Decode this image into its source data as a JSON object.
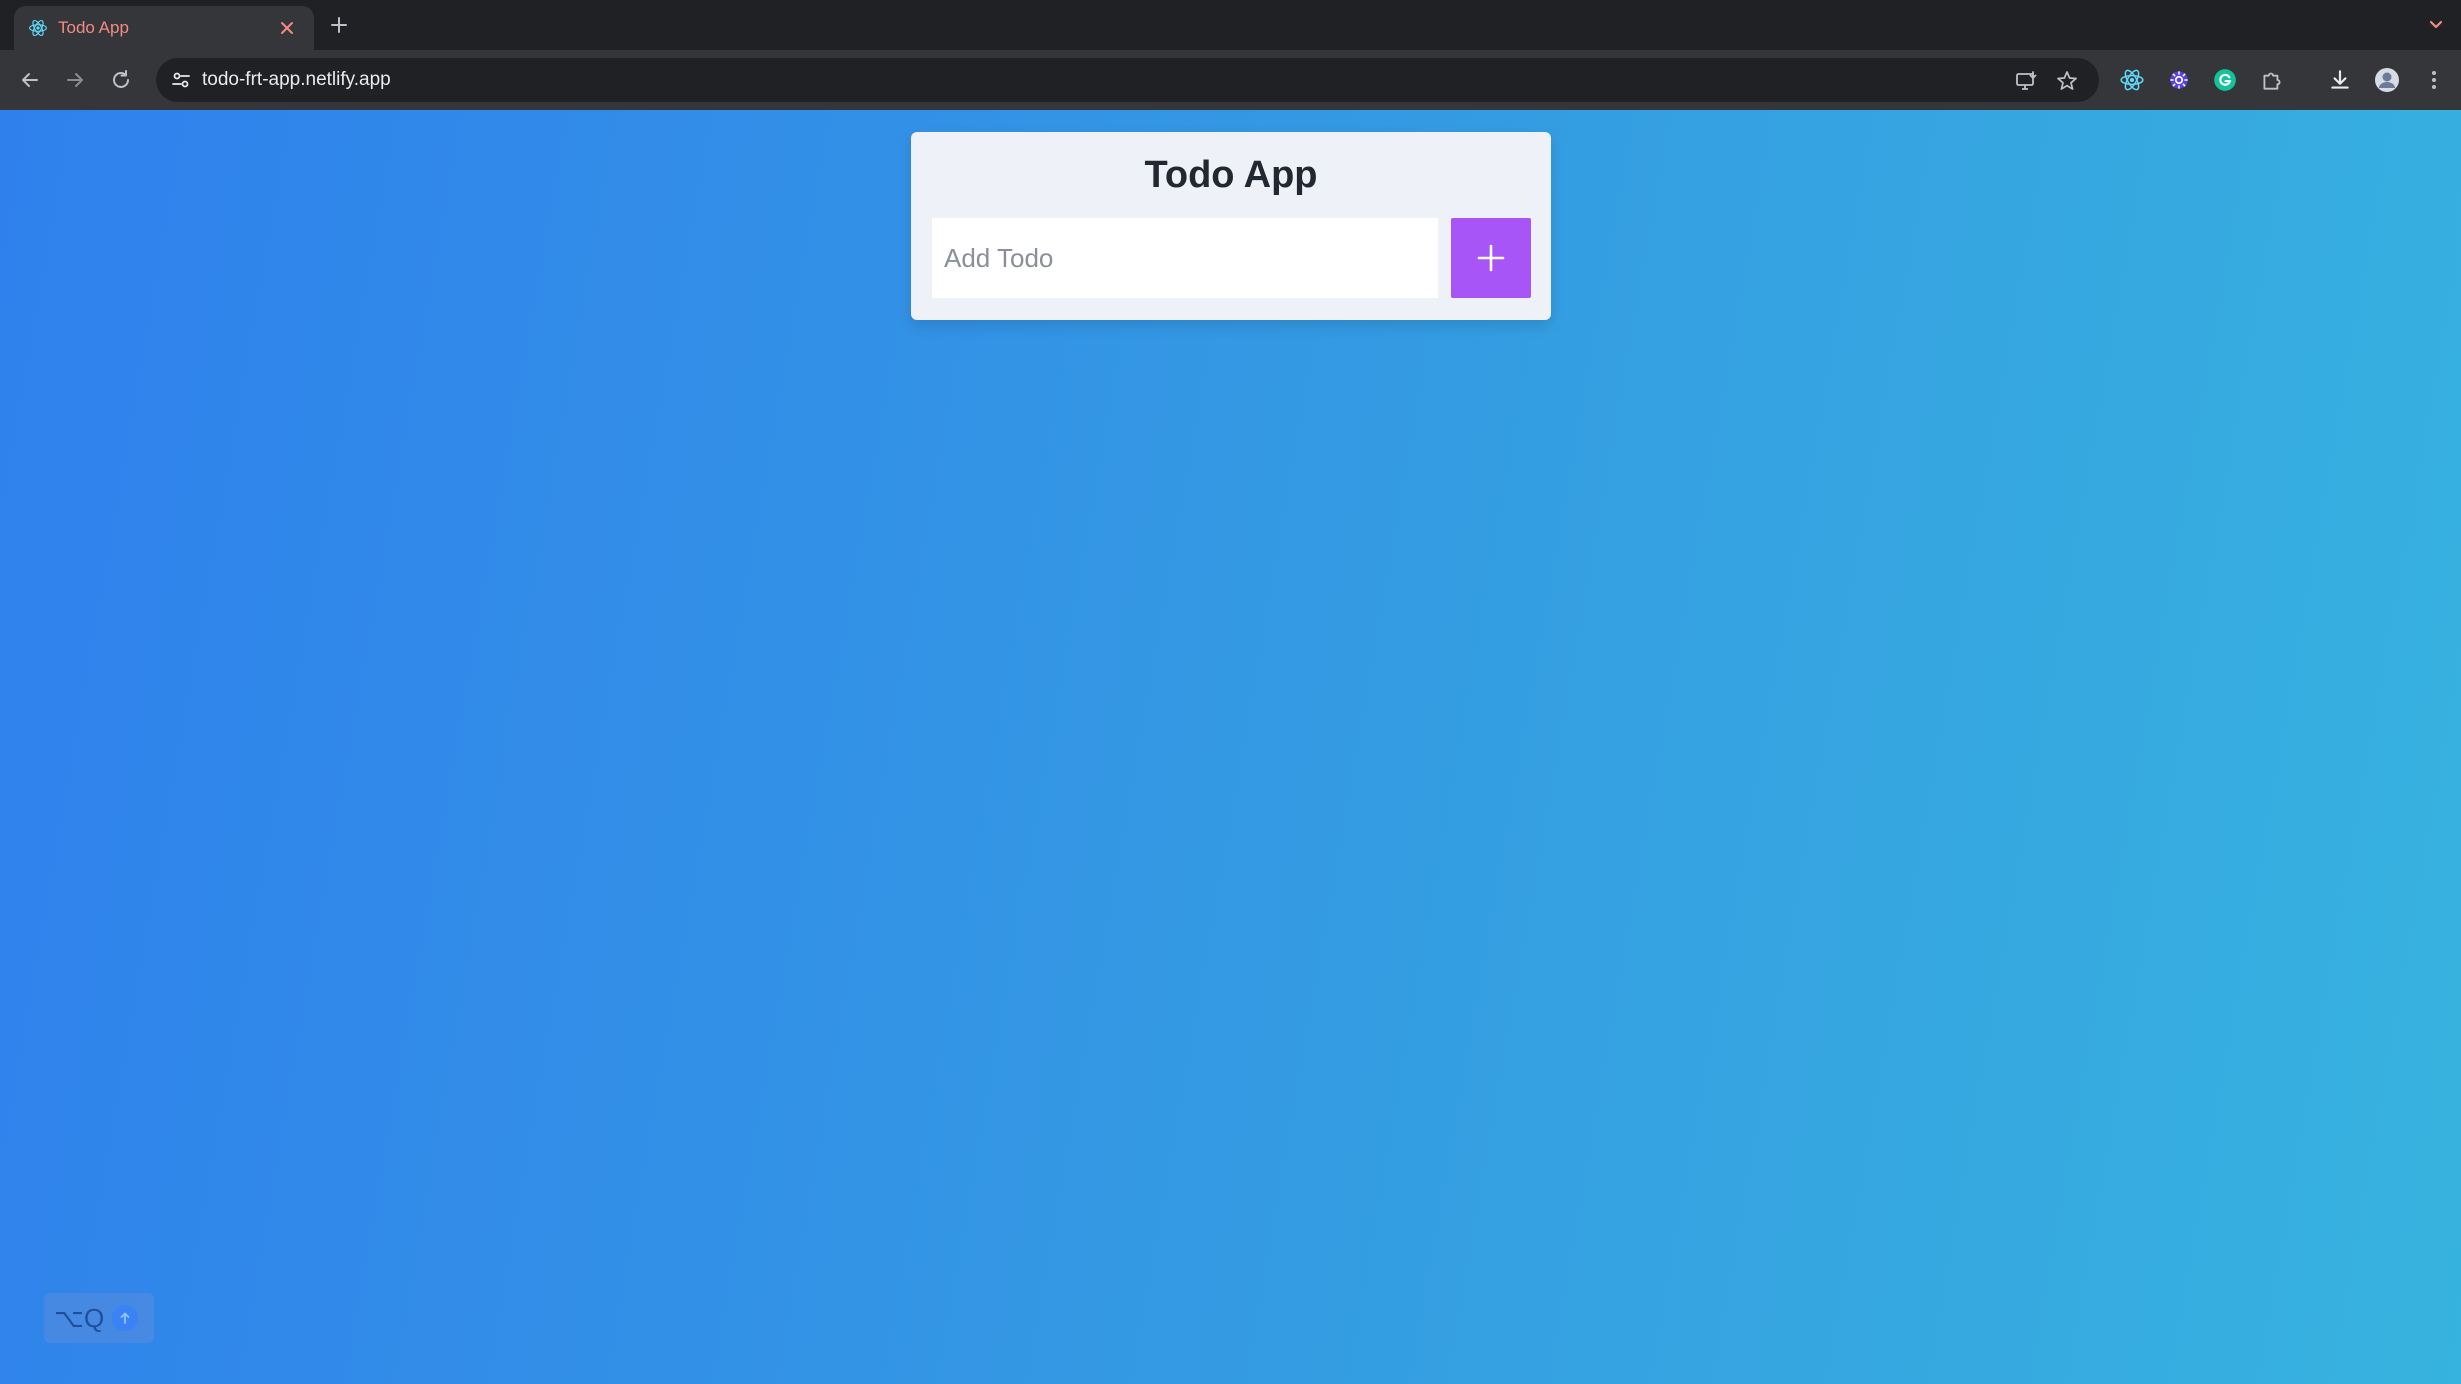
{
  "browser": {
    "tab": {
      "title": "Todo App",
      "favicon": "react-icon",
      "close_icon": "close-icon"
    },
    "new_tab_icon": "plus-icon",
    "tab_list_icon": "chevron-down-icon",
    "toolbar": {
      "back_icon": "arrow-left-icon",
      "forward_icon": "arrow-right-icon",
      "reload_icon": "reload-icon",
      "site_info_icon": "tune-icon",
      "url": "todo-frt-app.netlify.app",
      "omnibox_icons": [
        "install-app-icon",
        "star-icon"
      ],
      "extension_icons": [
        "react-devtools-icon",
        "gear-extension-icon",
        "grammarly-icon",
        "puzzle-icon"
      ],
      "download_icon": "download-icon",
      "profile_icon": "avatar",
      "menu_icon": "kebab-menu-icon"
    },
    "colors": {
      "tab_title": "#f28b82",
      "chrome_bg": "#202124"
    }
  },
  "app": {
    "title": "Todo App",
    "input": {
      "placeholder": "Add Todo",
      "value": ""
    },
    "add_button_icon": "plus-icon",
    "colors": {
      "accent": "#a855f7",
      "card_bg": "#eef1f7",
      "gradient_start": "#2f80ed",
      "gradient_end": "#37b3df"
    }
  },
  "widget": {
    "shortcut": "⌥Q",
    "icon": "arrow-up-icon"
  }
}
